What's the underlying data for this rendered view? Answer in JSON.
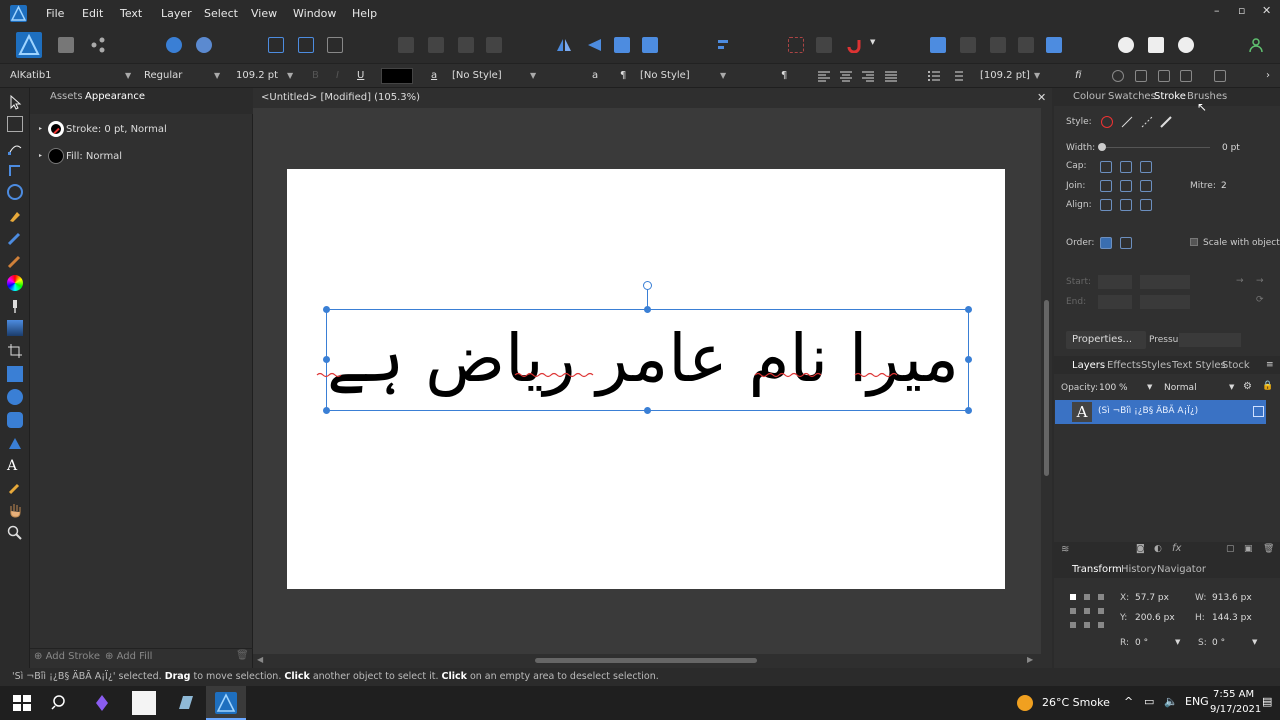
{
  "menu": [
    "File",
    "Edit",
    "Text",
    "Layer",
    "Select",
    "View",
    "Window",
    "Help"
  ],
  "context": {
    "font_family": "AlKatib1",
    "font_style": "Regular",
    "font_size": "109.2 pt",
    "char_style": "[No Style]",
    "para_style": "[No Style]",
    "leading": "[109.2 pt]",
    "underline_glyph": "U",
    "char_glyph": "a",
    "pilcrow_glyph": "¶"
  },
  "left_panel": {
    "tab_assets": "Assets",
    "tab_appearance": "Appearance",
    "stroke_label": "Stroke: 0 pt,  Normal",
    "fill_label": "Fill:  Normal",
    "add_stroke": "Add Stroke",
    "add_fill": "Add Fill"
  },
  "document": {
    "tab_title": "<Untitled> [Modified] (105.3%)",
    "text": "میرا نام عامر ریاض ہے"
  },
  "right_panel": {
    "tabs": [
      "Colour",
      "Swatches",
      "Stroke",
      "Brushes"
    ],
    "style_label": "Style:",
    "width_label": "Width:",
    "width_value": "0 pt",
    "cap_label": "Cap:",
    "join_label": "Join:",
    "mitre_label": "Mitre:",
    "mitre_value": "2",
    "align_label": "Align:",
    "order_label": "Order:",
    "scale_label": "Scale with object",
    "start_label": "Start:",
    "end_label": "End:",
    "properties_btn": "Properties...",
    "pressure_label": "Pressure:",
    "layer_tabs": [
      "Layers",
      "Effects",
      "Styles",
      "Text Styles",
      "Stock"
    ],
    "opacity_label": "Opacity:",
    "opacity_value": "100 %",
    "blend_mode": "Normal",
    "layer_name": "(Sì ¬Bîì ¡¿B§ ÄBÃ A¡Ï¿)",
    "transform_tabs": [
      "Transform",
      "History",
      "Navigator"
    ],
    "x_label": "X:",
    "x_value": "57.7 px",
    "y_label": "Y:",
    "y_value": "200.6 px",
    "w_label": "W:",
    "w_value": "913.6 px",
    "h_label": "H:",
    "h_value": "144.3 px",
    "r_label": "R:",
    "r_value": "0 °",
    "s_label": "S:",
    "s_value": "0 °"
  },
  "status": {
    "pre": "'Sì ¬Bîì ¡¿B§ ÄBÃ A¡Ï¿' selected. ",
    "b1": "Drag",
    "t1": " to move selection. ",
    "b2": "Click",
    "t2": " another object to select it. ",
    "b3": "Click",
    "t3": " on an empty area to deselect selection."
  },
  "taskbar": {
    "weather": "26°C  Smoke",
    "time": "7:55 AM",
    "date": "9/17/2021"
  },
  "colors": {
    "accent": "#3a7fd5",
    "app_logo": "#3a9be0"
  }
}
